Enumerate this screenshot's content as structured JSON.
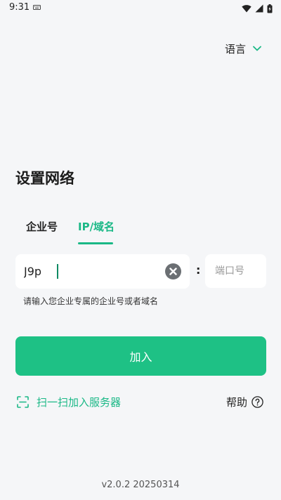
{
  "status_bar": {
    "time": "9:31"
  },
  "header": {
    "language_label": "语言"
  },
  "page": {
    "title": "设置网络"
  },
  "tabs": [
    {
      "label": "企业号",
      "active": false
    },
    {
      "label": "IP/域名",
      "active": true
    }
  ],
  "form": {
    "host_value": "J9p",
    "separator": ":",
    "port_value": "",
    "port_placeholder": "端口号",
    "hint": "请输入您企业专属的企业号或者域名"
  },
  "actions": {
    "join_label": "加入",
    "scan_label": "扫一扫加入服务器",
    "help_label": "帮助"
  },
  "footer": {
    "version": "v2.0.2 20250314"
  },
  "colors": {
    "accent": "#1ec185",
    "accent_text": "#1ab886",
    "background": "#f5f6f8"
  },
  "icons": {
    "language": "chevron-down-icon",
    "clear": "clear-circle-icon",
    "scan": "scan-icon",
    "help": "question-circle-icon"
  }
}
